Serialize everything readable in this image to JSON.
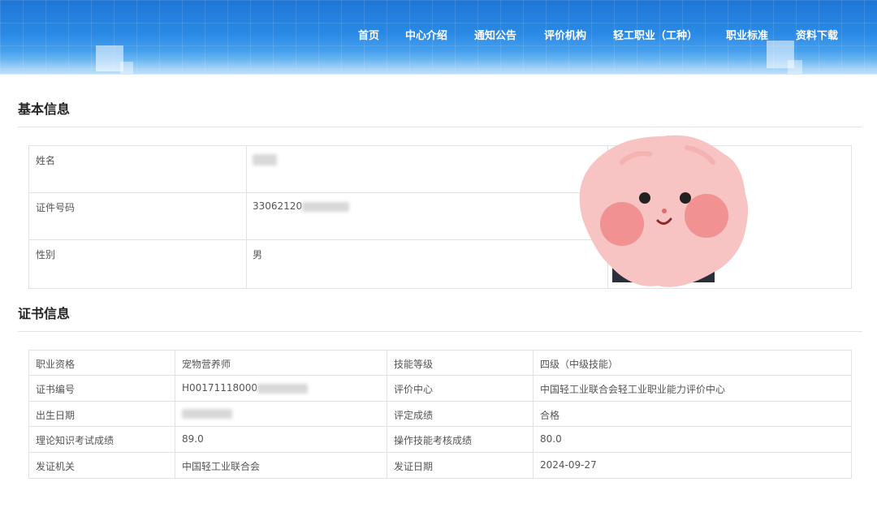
{
  "nav": {
    "items": [
      "首页",
      "中心介绍",
      "通知公告",
      "评价机构",
      "轻工职业（工种）",
      "职业标准",
      "资料下载"
    ]
  },
  "basic_info": {
    "title": "基本信息",
    "rows": [
      {
        "label": "姓名",
        "value": ""
      },
      {
        "label": "证件号码",
        "value": "33062120"
      },
      {
        "label": "性别",
        "value": "男"
      }
    ]
  },
  "certificate_info": {
    "title": "证书信息",
    "rows": [
      {
        "label1": "职业资格",
        "value1": "宠物营养师",
        "label2": "技能等级",
        "value2": "四级（中级技能）"
      },
      {
        "label1": "证书编号",
        "value1": "H00171118000",
        "label2": "评价中心",
        "value2": "中国轻工业联合会轻工业职业能力评价中心"
      },
      {
        "label1": "出生日期",
        "value1": "",
        "label2": "评定成绩",
        "value2": "合格"
      },
      {
        "label1": "理论知识考试成绩",
        "value1": "89.0",
        "label2": "操作技能考核成绩",
        "value2": "80.0"
      },
      {
        "label1": "发证机关",
        "value1": "中国轻工业联合会",
        "label2": "发证日期",
        "value2": "2024-09-27"
      }
    ]
  },
  "colors": {
    "banner_top": "#1e76d6",
    "banner_bottom": "#9fd2f7",
    "nav_text": "#ffffff",
    "border": "#e2e2e2",
    "sticker_pink": "#f7c3c3",
    "sticker_cheek": "#f08c8c"
  },
  "icons": {
    "photo_overlay": "cartoon-face-sticker-icon"
  }
}
